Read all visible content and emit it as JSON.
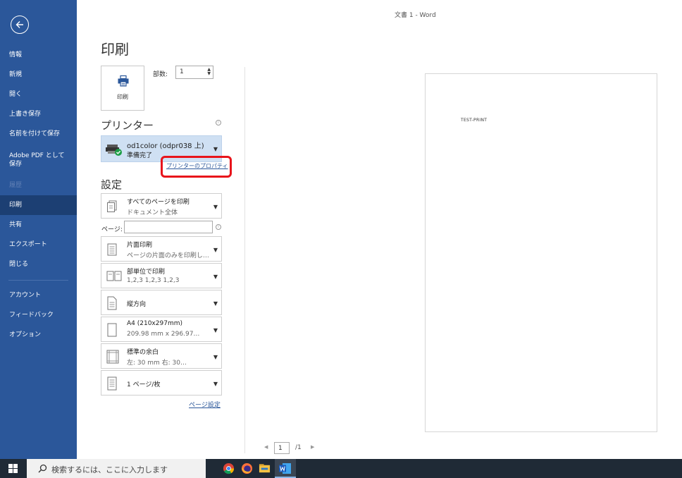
{
  "window": {
    "title": "文書 1  -  Word"
  },
  "sidebar": {
    "items": [
      {
        "label": "情報"
      },
      {
        "label": "新規"
      },
      {
        "label": "開く"
      },
      {
        "label": "上書き保存"
      },
      {
        "label": "名前を付けて保存"
      },
      {
        "label": "Adobe PDF として保存"
      },
      {
        "label": "履歴"
      },
      {
        "label": "印刷"
      },
      {
        "label": "共有"
      },
      {
        "label": "エクスポート"
      },
      {
        "label": "閉じる"
      },
      {
        "label": "アカウント"
      },
      {
        "label": "フィードバック"
      },
      {
        "label": "オプション"
      }
    ],
    "active": "印刷",
    "colors": {
      "background": "#2b579a",
      "active": "#1c3f73"
    }
  },
  "main": {
    "heading": "印刷",
    "print_button": {
      "label": "印刷"
    },
    "copies": {
      "label": "部数:",
      "value": "1"
    },
    "printer": {
      "heading": "プリンター",
      "name": "od1color (odpr038 上)",
      "status": "準備完了",
      "properties_link": "プリンターのプロパティ"
    },
    "settings": {
      "heading": "設定",
      "pages_label": "ページ:",
      "pages_value": "",
      "page_setup_link": "ページ設定",
      "dropdowns": [
        {
          "line1": "すべてのページを印刷",
          "line2": "ドキュメント全体"
        },
        {
          "line1": "片面印刷",
          "line2": "ページの片面のみを印刷し…"
        },
        {
          "line1": "部単位で印刷",
          "line2": "1,2,3   1,2,3   1,2,3"
        },
        {
          "line1": "縦方向",
          "line2": ""
        },
        {
          "line1": "A4 (210x297mm)",
          "line2": "209.98 mm x 296.97…"
        },
        {
          "line1": "標準の余白",
          "line2": "左: 30 mm   右: 30…"
        },
        {
          "line1": "1 ページ/枚",
          "line2": ""
        }
      ]
    }
  },
  "preview": {
    "text": "TEST-PRINT",
    "current_page": "1",
    "total_pages": "/1"
  },
  "taskbar": {
    "search_placeholder": "検索するには、ここに入力します",
    "apps": [
      "chrome-icon",
      "firefox-icon",
      "file-explorer-icon",
      "word-icon"
    ]
  },
  "colors": {
    "accent": "#2b579a",
    "highlight": "#e8141b",
    "printer_selected": "#cfe0f3"
  }
}
